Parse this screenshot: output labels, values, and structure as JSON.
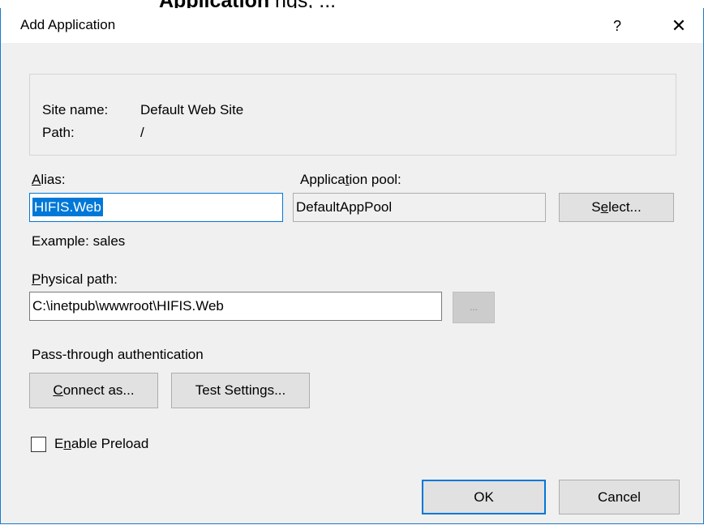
{
  "cropped_heading": {
    "bold": "Application",
    "rest": " ngs, ..."
  },
  "window": {
    "title": "Add Application",
    "help_label": "?",
    "close_label": "✕"
  },
  "info": {
    "site_name_label": "Site name:",
    "site_name_value": "Default Web Site",
    "path_label": "Path:",
    "path_value": "/"
  },
  "alias": {
    "label_mnemonic": "A",
    "label_rest": "lias:",
    "value": "HIFIS.Web",
    "example": "Example: sales"
  },
  "app_pool": {
    "label_pre": "Applica",
    "label_mnemonic": "t",
    "label_post": "ion pool:",
    "value": "DefaultAppPool",
    "select_pre": "S",
    "select_mnemonic": "e",
    "select_post": "lect..."
  },
  "physical_path": {
    "label_mnemonic": "P",
    "label_rest": "hysical path:",
    "value": "C:\\inetpub\\wwwroot\\HIFIS.Web",
    "browse_label": "..."
  },
  "passthrough": {
    "label": "Pass-through authentication",
    "connect_mnemonic": "C",
    "connect_rest": "onnect as...",
    "test_pre": "Test Settin",
    "test_mnemonic": "g",
    "test_post": "s..."
  },
  "preload": {
    "checked": false,
    "label_pre": "E",
    "label_mnemonic": "n",
    "label_post": "able Preload"
  },
  "footer": {
    "ok_label": "OK",
    "cancel_label": "Cancel"
  }
}
